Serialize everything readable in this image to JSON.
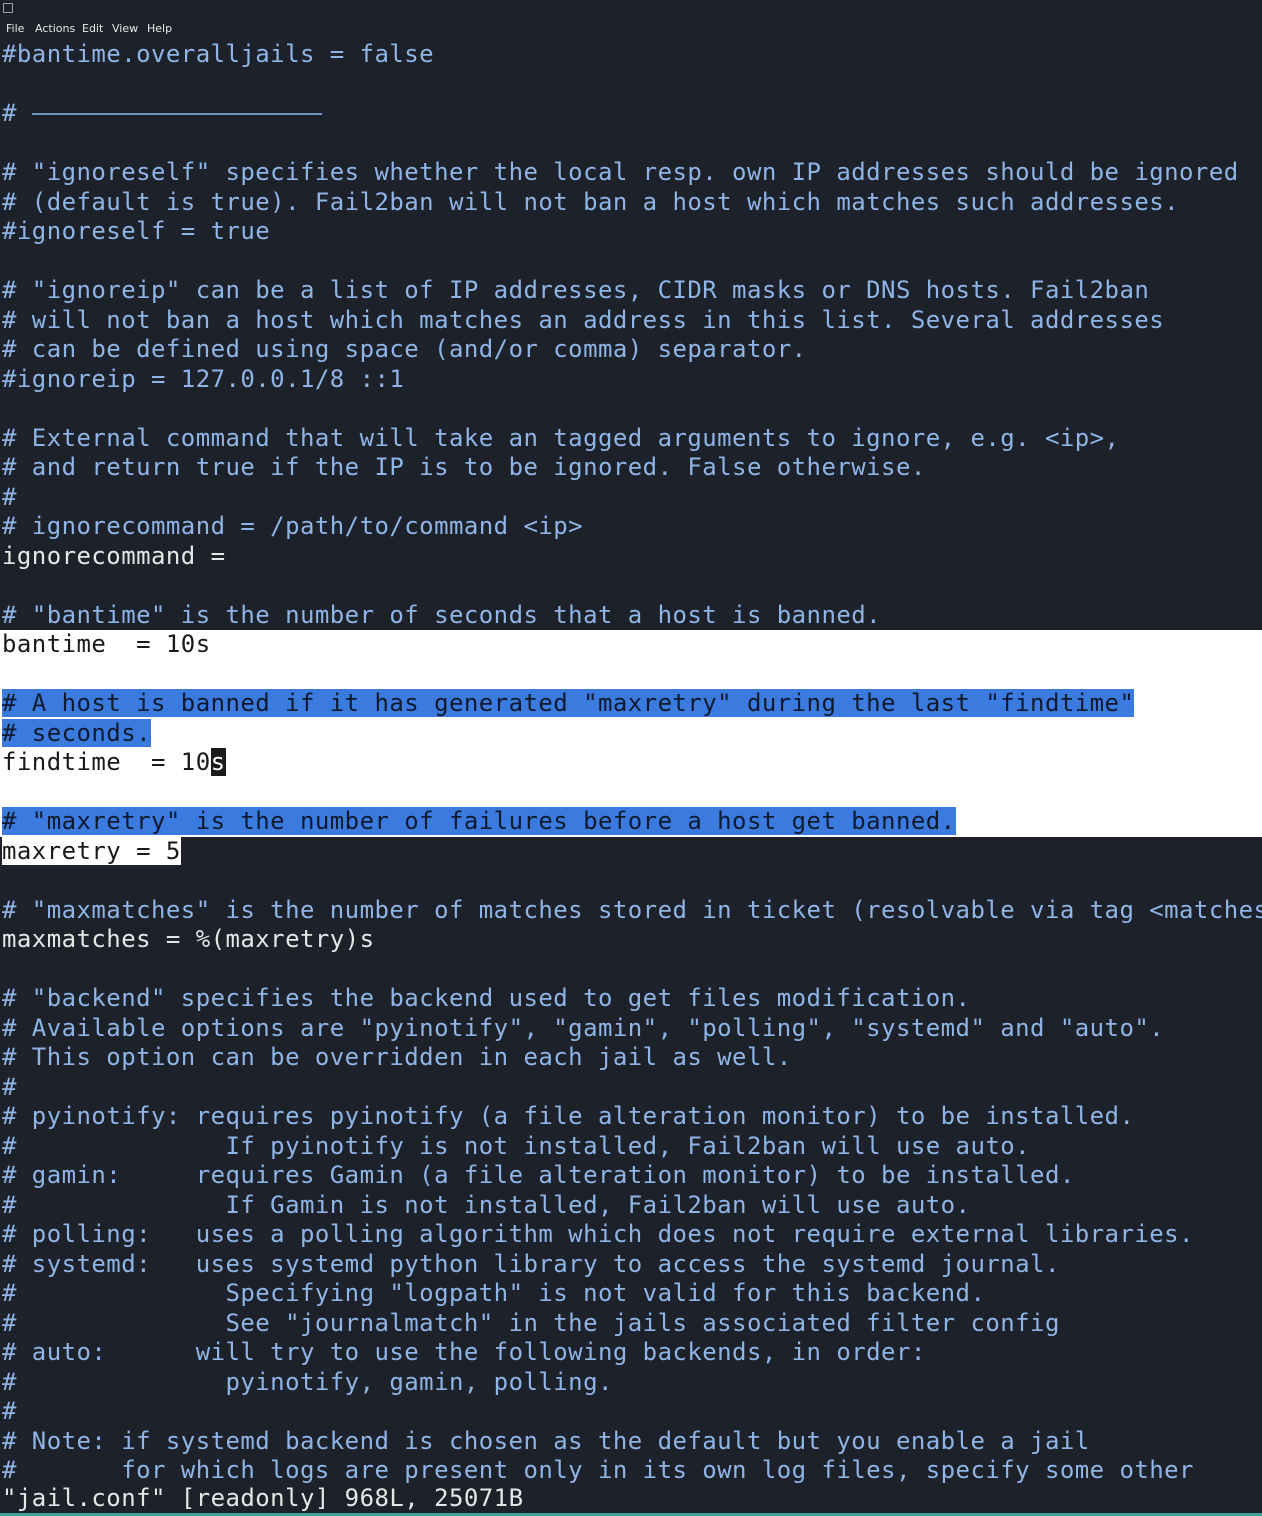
{
  "menu": [
    "File",
    "Actions",
    "Edit",
    "View",
    "Help"
  ],
  "lines": [
    "#bantime.overalljails = false",
    "",
    "# ",
    "",
    "# \"ignoreself\" specifies whether the local resp. own IP addresses should be ignored",
    "# (default is true). Fail2ban will not ban a host which matches such addresses.",
    "#ignoreself = true",
    "",
    "# \"ignoreip\" can be a list of IP addresses, CIDR masks or DNS hosts. Fail2ban",
    "# will not ban a host which matches an address in this list. Several addresses",
    "# can be defined using space (and/or comma) separator.",
    "#ignoreip = 127.0.0.1/8 ::1",
    "",
    "# External command that will take an tagged arguments to ignore, e.g. <ip>,",
    "# and return true if the IP is to be ignored. False otherwise.",
    "#",
    "# ignorecommand = /path/to/command <ip>",
    "ignorecommand =",
    "",
    "# \"bantime\" is the number of seconds that a host is banned.",
    "bantime  = 10s",
    "",
    "# A host is banned if it has generated \"maxretry\" during the last \"findtime\"",
    "# seconds.",
    "findtime  = 10",
    "",
    "# \"maxretry\" is the number of failures before a host get banned.",
    "maxretry = 5",
    "",
    "# \"maxmatches\" is the number of matches stored in ticket (resolvable via tag <matches> in actions).",
    "maxmatches = %(maxretry)s",
    "",
    "# \"backend\" specifies the backend used to get files modification.",
    "# Available options are \"pyinotify\", \"gamin\", \"polling\", \"systemd\" and \"auto\".",
    "# This option can be overridden in each jail as well.",
    "#",
    "# pyinotify: requires pyinotify (a file alteration monitor) to be installed.",
    "#              If pyinotify is not installed, Fail2ban will use auto.",
    "# gamin:     requires Gamin (a file alteration monitor) to be installed.",
    "#              If Gamin is not installed, Fail2ban will use auto.",
    "# polling:   uses a polling algorithm which does not require external libraries.",
    "# systemd:   uses systemd python library to access the systemd journal.",
    "#              Specifying \"logpath\" is not valid for this backend.",
    "#              See \"journalmatch\" in the jails associated filter config",
    "# auto:      will try to use the following backends, in order:",
    "#              pyinotify, gamin, polling.",
    "#",
    "# Note: if systemd backend is chosen as the default but you enable a jail",
    "#       for which logs are present only in its own log files, specify some other"
  ],
  "cursor_char": "s",
  "status": "\"jail.conf\" [readonly] 968L, 25071B",
  "colors": {
    "background": "#1d212a",
    "comment": "#8fb4e6",
    "text": "#e6e6e6",
    "selection_blue": "#3b7be0",
    "selection_white": "#ffffff"
  }
}
